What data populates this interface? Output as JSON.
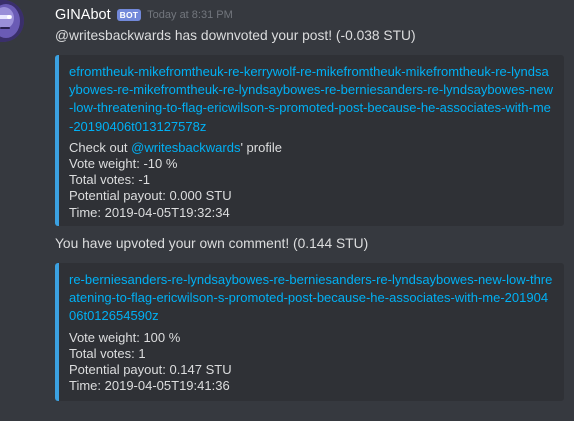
{
  "message": {
    "username": "GINAbot",
    "badge": "BOT",
    "timestamp": "Today at 8:31 PM",
    "avatar_icon": "robot-face-avatar",
    "text_1": "@writesbackwards has downvoted your post! (-0.038 STU)",
    "embed_1": {
      "link": "efromtheuk-mikefromtheuk-re-kerrywolf-re-mikefromtheuk-mikefromtheuk-re-lyndsaybowes-re-mikefromtheuk-re-lyndsaybowes-re-berniesanders-re-lyndsaybowes-new-low-threatening-to-flag-ericwilson-s-promoted-post-because-he-associates-with-me-20190406t013127578z",
      "profile_prefix": "Check out ",
      "profile_link": "@writesbackwards",
      "profile_suffix": "' profile",
      "vote_weight": "Vote weight: -10 %",
      "total_votes": "Total votes: -1",
      "potential_payout": "Potential payout: 0.000 STU",
      "time": "Time: 2019-04-05T19:32:34"
    },
    "text_2": "You have upvoted your own comment! (0.144 STU)",
    "embed_2": {
      "link": "re-berniesanders-re-lyndsaybowes-re-berniesanders-re-lyndsaybowes-new-low-threatening-to-flag-ericwilson-s-promoted-post-because-he-associates-with-me-20190406t012654590z",
      "vote_weight": "Vote weight: 100 %",
      "total_votes": "Total votes: 1",
      "potential_payout": "Potential payout: 0.147 STU",
      "time": "Time: 2019-04-05T19:41:36"
    }
  },
  "colors": {
    "background": "#36393f",
    "embed_background": "#2f3136",
    "embed_accent": "#3ba1e1",
    "link": "#00b0f4",
    "text": "#dcddde",
    "badge": "#7289da",
    "timestamp": "#72767d"
  }
}
